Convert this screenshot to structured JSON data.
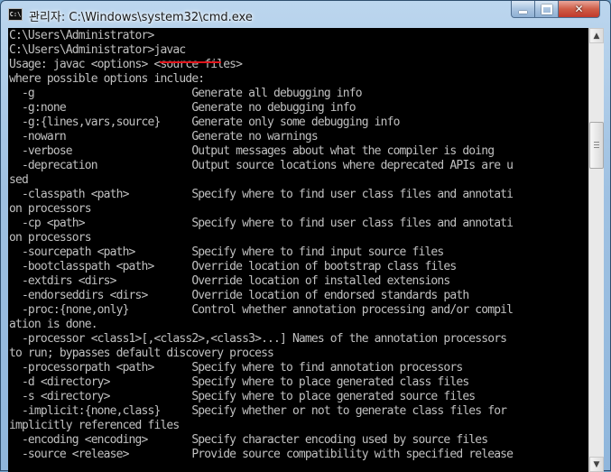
{
  "window": {
    "title": "관리자: C:\\Windows\\system32\\cmd.exe",
    "icon": "cmd-icon",
    "icon_text": "C:\\",
    "buttons": {
      "minimize": "minimize-icon",
      "maximize": "maximize-icon",
      "close": "✕"
    }
  },
  "console": {
    "lines": [
      "C:\\Users\\Administrator>",
      "C:\\Users\\Administrator>javac",
      "Usage: javac <options> <source files>",
      "where possible options include:",
      "  -g                         Generate all debugging info",
      "  -g:none                    Generate no debugging info",
      "  -g:{lines,vars,source}     Generate only some debugging info",
      "  -nowarn                    Generate no warnings",
      "  -verbose                   Output messages about what the compiler is doing",
      "  -deprecation               Output source locations where deprecated APIs are u",
      "sed",
      "  -classpath <path>          Specify where to find user class files and annotati",
      "on processors",
      "  -cp <path>                 Specify where to find user class files and annotati",
      "on processors",
      "  -sourcepath <path>         Specify where to find input source files",
      "  -bootclasspath <path>      Override location of bootstrap class files",
      "  -extdirs <dirs>            Override location of installed extensions",
      "  -endorseddirs <dirs>       Override location of endorsed standards path",
      "  -proc:{none,only}          Control whether annotation processing and/or compil",
      "ation is done.",
      "  -processor <class1>[,<class2>,<class3>...] Names of the annotation processors",
      "to run; bypasses default discovery process",
      "  -processorpath <path>      Specify where to find annotation processors",
      "  -d <directory>             Specify where to place generated class files",
      "  -s <directory>             Specify where to place generated source files",
      "  -implicit:{none,class}     Specify whether or not to generate class files for",
      "implicitly referenced files",
      "  -encoding <encoding>       Specify character encoding used by source files",
      "  -source <release>          Provide source compatibility with specified release"
    ],
    "highlight_color": "#e0141b"
  },
  "scrollbar": {
    "up": "▲",
    "down": "▼"
  }
}
